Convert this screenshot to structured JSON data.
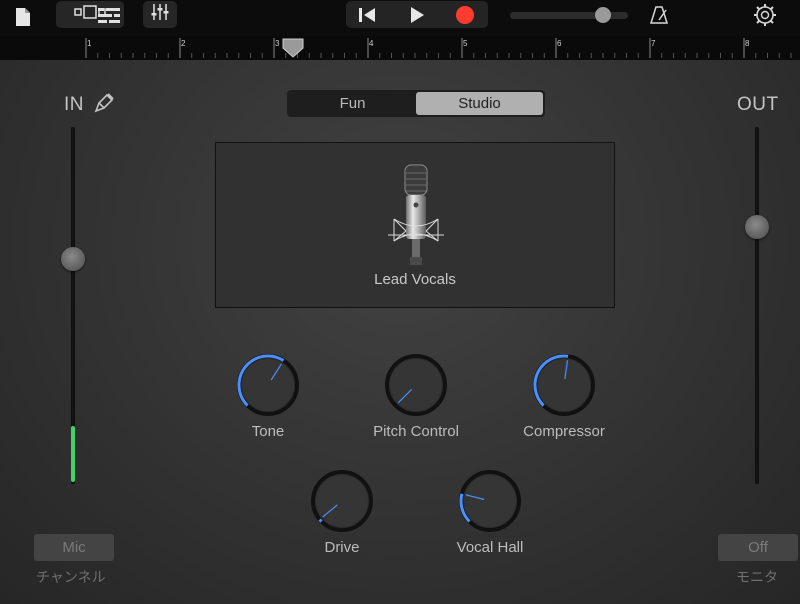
{
  "toolbar": {
    "icons": [
      "document-icon",
      "tracks-view-icon",
      "song-sections-icon",
      "mixer-icon",
      "rewind-icon",
      "play-icon",
      "record-icon",
      "volume-slider",
      "metronome-icon",
      "settings-icon"
    ],
    "volume_level": 0.77
  },
  "ruler": {
    "bars": [
      "1",
      "2",
      "3",
      "4",
      "5",
      "6",
      "7",
      "8"
    ],
    "playhead_bar": 3.2
  },
  "input": {
    "title": "IN",
    "level": 0.63,
    "button_label": "Mic",
    "caption": "チャンネル"
  },
  "output": {
    "title": "OUT",
    "level": 0.72,
    "button_label": "Off",
    "caption": "モニタ"
  },
  "mode": {
    "options": [
      "Fun",
      "Studio"
    ],
    "selected": "Studio"
  },
  "patch": {
    "name": "Lead Vocals"
  },
  "knobs": [
    {
      "label": "Tone",
      "value": 0.62
    },
    {
      "label": "Pitch Control",
      "value": 0.0
    },
    {
      "label": "Compressor",
      "value": 0.53
    },
    {
      "label": "Drive",
      "value": 0.02
    },
    {
      "label": "Vocal Hall",
      "value": 0.22
    }
  ],
  "colors": {
    "accent": "#4a90ff",
    "record": "#ff3b30",
    "meter": "#3fd46a"
  }
}
